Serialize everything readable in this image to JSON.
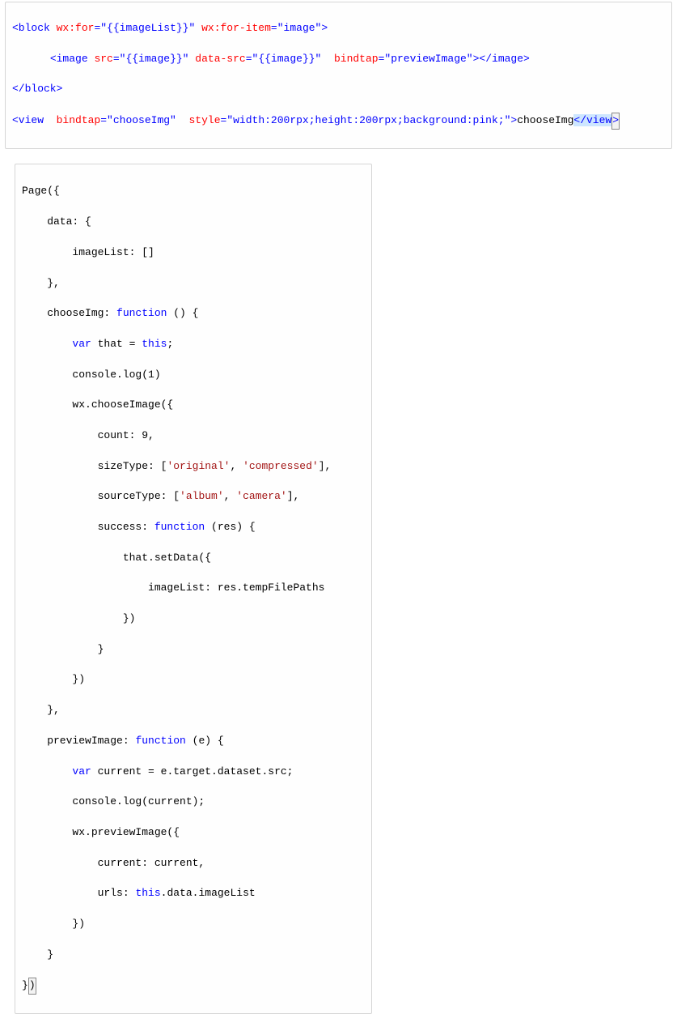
{
  "block1": {
    "l1_open": "<block",
    "l1_a1n": "wx:for",
    "l1_a1v": "\"{{imageList}}\"",
    "l1_a2n": "wx:for-item",
    "l1_a2v": "\"image\"",
    "l1_close": ">",
    "l2_indent": "      ",
    "l2_open": "<image",
    "l2_a1n": "src",
    "l2_a1v": "\"{{image}}\"",
    "l2_a2n": "data-src",
    "l2_a2v": "\"{{image}}\"",
    "l2_a3n": "bindtap",
    "l2_a3v": "\"previewImage\"",
    "l2_close": "></image>",
    "l3": "</block>",
    "l4_open": "<view",
    "l4_a1n": "bindtap",
    "l4_a1v": "\"chooseImg\"",
    "l4_a2n": "style",
    "l4_a2v": "\"width:200rpx;height:200rpx;background:pink;\"",
    "l4_gt": ">",
    "l4_txt": "chooseImg",
    "l4_end_open": "</view",
    "l4_end_gt": ">"
  },
  "block2": {
    "l01": "Page({",
    "l02": "    data: {",
    "l03": "        imageList: []",
    "l04": "    },",
    "l05_a": "    chooseImg: ",
    "l05_kw": "function",
    "l05_b": " () {",
    "l06_a": "        ",
    "l06_kw": "var",
    "l06_b": " that = ",
    "l06_kw2": "this",
    "l06_c": ";",
    "l07": "        console.log(1)",
    "l08": "        wx.chooseImage({",
    "l09": "            count: 9,",
    "l10_a": "            sizeType: [",
    "l10_s1": "'original'",
    "l10_m": ", ",
    "l10_s2": "'compressed'",
    "l10_b": "],",
    "l11_a": "            sourceType: [",
    "l11_s1": "'album'",
    "l11_m": ", ",
    "l11_s2": "'camera'",
    "l11_b": "],",
    "l12_a": "            success: ",
    "l12_kw": "function",
    "l12_b": " (res) {",
    "l13": "                that.setData({",
    "l14": "                    imageList: res.tempFilePaths",
    "l15": "                })",
    "l16": "            }",
    "l17": "        })",
    "l18": "    },",
    "l19_a": "    previewImage: ",
    "l19_kw": "function",
    "l19_b": " (e) {",
    "l20_a": "        ",
    "l20_kw": "var",
    "l20_b": " current = e.target.dataset.src;",
    "l21": "        console.log(current);",
    "l22": "        wx.previewImage({",
    "l23": "            current: current,",
    "l24_a": "            urls: ",
    "l24_kw": "this",
    "l24_b": ".data.imageList",
    "l25": "        })",
    "l26": "    }",
    "l27a": "}",
    "l27b": ")"
  }
}
